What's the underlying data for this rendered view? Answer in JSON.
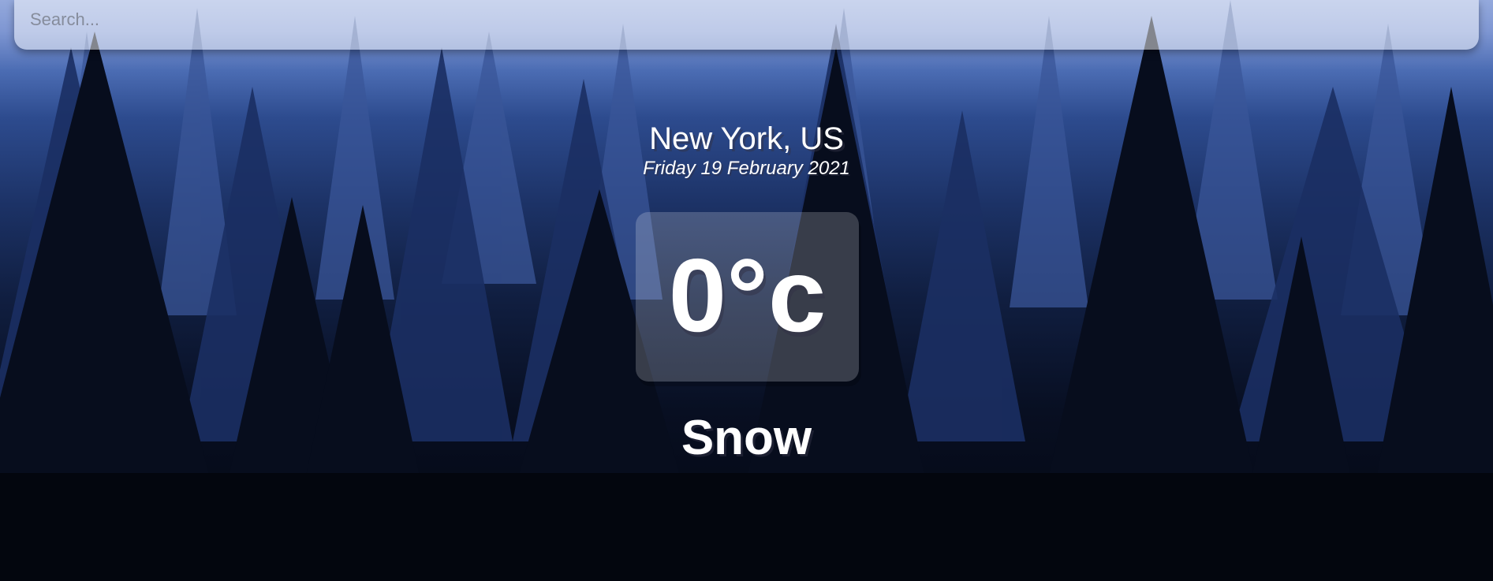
{
  "search": {
    "placeholder": "Search...",
    "value": ""
  },
  "location": {
    "city": "New York, US",
    "date": "Friday 19 February 2021"
  },
  "weather": {
    "temperature": "0°c",
    "condition": "Snow"
  },
  "colors": {
    "sky_top": "#94a9dc",
    "sky_mid": "#2d4b8e",
    "ground": "#03060e",
    "text": "#ffffff"
  },
  "icons": {
    "background": "forest-silhouette-image"
  }
}
